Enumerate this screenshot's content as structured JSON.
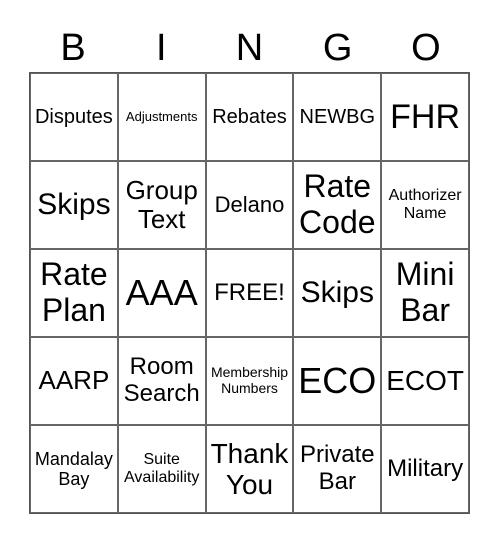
{
  "header": {
    "letters": [
      "B",
      "I",
      "N",
      "G",
      "O"
    ]
  },
  "cells": [
    {
      "text": "Disputes",
      "size": "s20"
    },
    {
      "text": "Adjustments",
      "size": "s13"
    },
    {
      "text": "Rebates",
      "size": "s20"
    },
    {
      "text": "NEWBG",
      "size": "s20"
    },
    {
      "text": "FHR",
      "size": "s34"
    },
    {
      "text": "Skips",
      "size": "s30"
    },
    {
      "text": "Group Text",
      "size": "s26"
    },
    {
      "text": "Delano",
      "size": "s22"
    },
    {
      "text": "Rate Code",
      "size": "s32"
    },
    {
      "text": "Authorizer Name",
      "size": "s16"
    },
    {
      "text": "Rate Plan",
      "size": "s32"
    },
    {
      "text": "AAA",
      "size": "s36"
    },
    {
      "text": "FREE!",
      "size": "s24"
    },
    {
      "text": "Skips",
      "size": "s30"
    },
    {
      "text": "Mini Bar",
      "size": "s32"
    },
    {
      "text": "AARP",
      "size": "s26"
    },
    {
      "text": "Room Search",
      "size": "s24"
    },
    {
      "text": "Membership Numbers",
      "size": "s14"
    },
    {
      "text": "ECO",
      "size": "s36"
    },
    {
      "text": "ECOT",
      "size": "s28"
    },
    {
      "text": "Mandalay Bay",
      "size": "s18"
    },
    {
      "text": "Suite Availability",
      "size": "s16"
    },
    {
      "text": "Thank You",
      "size": "s28"
    },
    {
      "text": "Private Bar",
      "size": "s24"
    },
    {
      "text": "Military",
      "size": "s24"
    }
  ]
}
